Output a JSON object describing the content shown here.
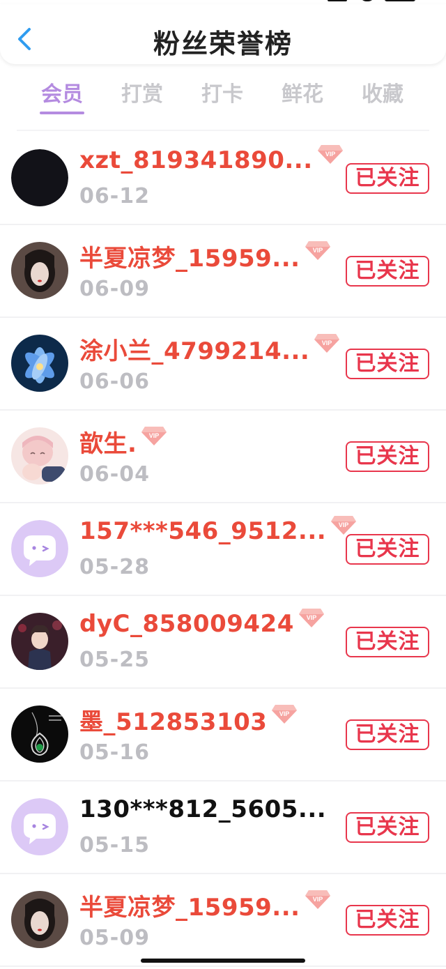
{
  "header": {
    "title": "粉丝荣誉榜"
  },
  "tabs": [
    {
      "label": "会员",
      "active": true
    },
    {
      "label": "打赏",
      "active": false
    },
    {
      "label": "打卡",
      "active": false
    },
    {
      "label": "鲜花",
      "active": false
    },
    {
      "label": "收藏",
      "active": false
    }
  ],
  "colors": {
    "accent": "#b48be0",
    "name_red": "#ea4a3a",
    "follow_red": "#e8364c",
    "date_gray": "#bdbdc2"
  },
  "fans": [
    {
      "name": "xzt_819341890...",
      "date": "06-12",
      "vip": true,
      "follow_label": "已关注",
      "avatar": "black-avatar",
      "name_color": "red"
    },
    {
      "name": "半夏凉梦_15959...",
      "date": "06-09",
      "vip": true,
      "follow_label": "已关注",
      "avatar": "girl-portrait-avatar",
      "name_color": "red"
    },
    {
      "name": "涂小兰_4799214...",
      "date": "06-06",
      "vip": true,
      "follow_label": "已关注",
      "avatar": "lotus-flower-avatar",
      "name_color": "red"
    },
    {
      "name": "歆生.",
      "date": "06-04",
      "vip": true,
      "follow_label": "已关注",
      "avatar": "anime-girl-avatar",
      "name_color": "red"
    },
    {
      "name": "157***546_9512...",
      "date": "05-28",
      "vip": true,
      "follow_label": "已关注",
      "avatar": "default-chat-avatar",
      "name_color": "red"
    },
    {
      "name": "dyC_858009424",
      "date": "05-25",
      "vip": true,
      "follow_label": "已关注",
      "avatar": "anime-boy-avatar",
      "name_color": "red"
    },
    {
      "name": "墨_512853103",
      "date": "05-16",
      "vip": true,
      "follow_label": "已关注",
      "avatar": "pendant-avatar",
      "name_color": "red"
    },
    {
      "name": "130***812_5605...",
      "date": "05-15",
      "vip": false,
      "follow_label": "已关注",
      "avatar": "default-chat-avatar",
      "name_color": "black"
    },
    {
      "name": "半夏凉梦_15959...",
      "date": "05-09",
      "vip": true,
      "follow_label": "已关注",
      "avatar": "girl-portrait-avatar",
      "name_color": "red"
    }
  ]
}
